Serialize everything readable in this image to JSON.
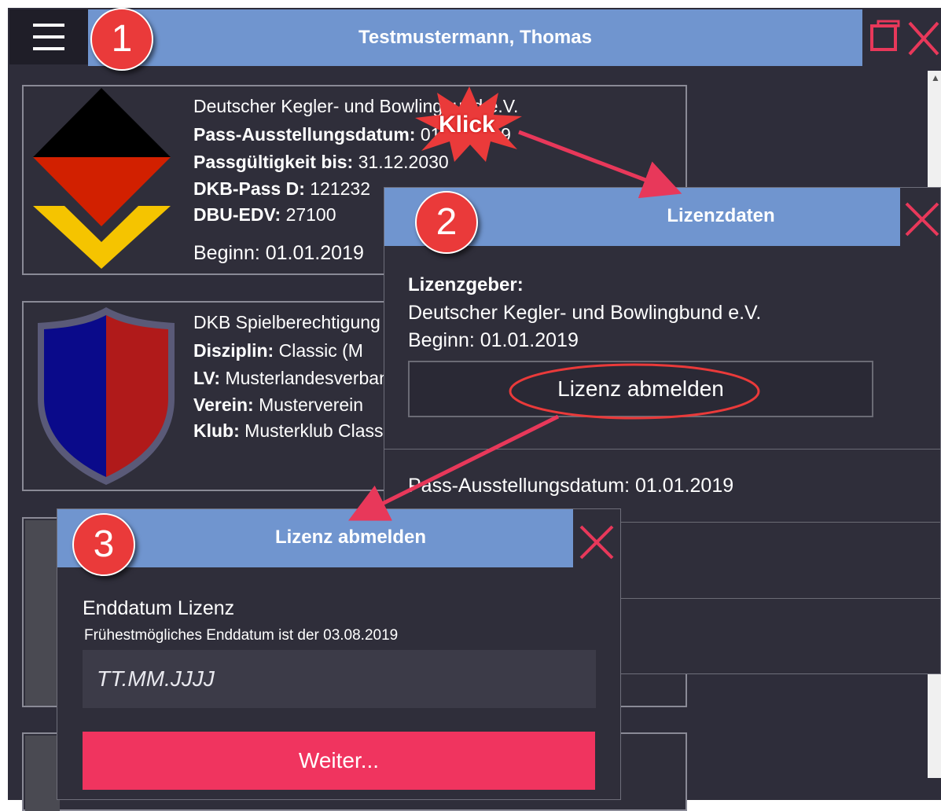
{
  "app": {
    "title": "Testmustermann, Thomas"
  },
  "cards": [
    {
      "org": "Deutscher Kegler- und Bowlingbund e.V.",
      "rows": [
        {
          "label": "Pass-Ausstellungsdatum:",
          "value": "01.01.2019"
        },
        {
          "label": "Passgültigkeit bis:",
          "value": "31.12.2030"
        },
        {
          "label": "DKB-Pass D:",
          "value": "121232"
        },
        {
          "label": "DBU-EDV:",
          "value": "27100"
        }
      ],
      "begin": "Beginn: 01.01.2019"
    },
    {
      "title": "DKB Spielberechtigung",
      "rows": [
        {
          "label": "Disziplin:",
          "value": "Classic (M"
        },
        {
          "label": "LV:",
          "value": "Musterlandesverband"
        },
        {
          "label": "Verein:",
          "value": "Musterverein"
        },
        {
          "label": "Klub:",
          "value": "Musterklub Classic"
        }
      ]
    }
  ],
  "annotations": {
    "klick": "Klick",
    "step1": "1",
    "step2": "2",
    "step3": "3"
  },
  "dialog_lizenzdaten": {
    "title": "Lizenzdaten",
    "licensor_label": "Lizenzgeber:",
    "licensor": "Deutscher Kegler- und Bowlingbund e.V.",
    "begin": "Beginn: 01.01.2019",
    "deregister_button": "Lizenz abmelden",
    "issue_date": "Pass-Ausstellungsdatum: 01.01.2019"
  },
  "dialog_abmelden": {
    "title": "Lizenz abmelden",
    "end_label": "Enddatum Lizenz",
    "hint": "Frühestmögliches Enddatum ist der 03.08.2019",
    "date_placeholder": "TT.MM.JJJJ",
    "next_button": "Weiter..."
  },
  "colors": {
    "header": "#7095cf",
    "background": "#2e2d3a",
    "accent_red": "#ea3a3a",
    "close_x": "#e8385a",
    "primary_button": "#f0345f"
  }
}
